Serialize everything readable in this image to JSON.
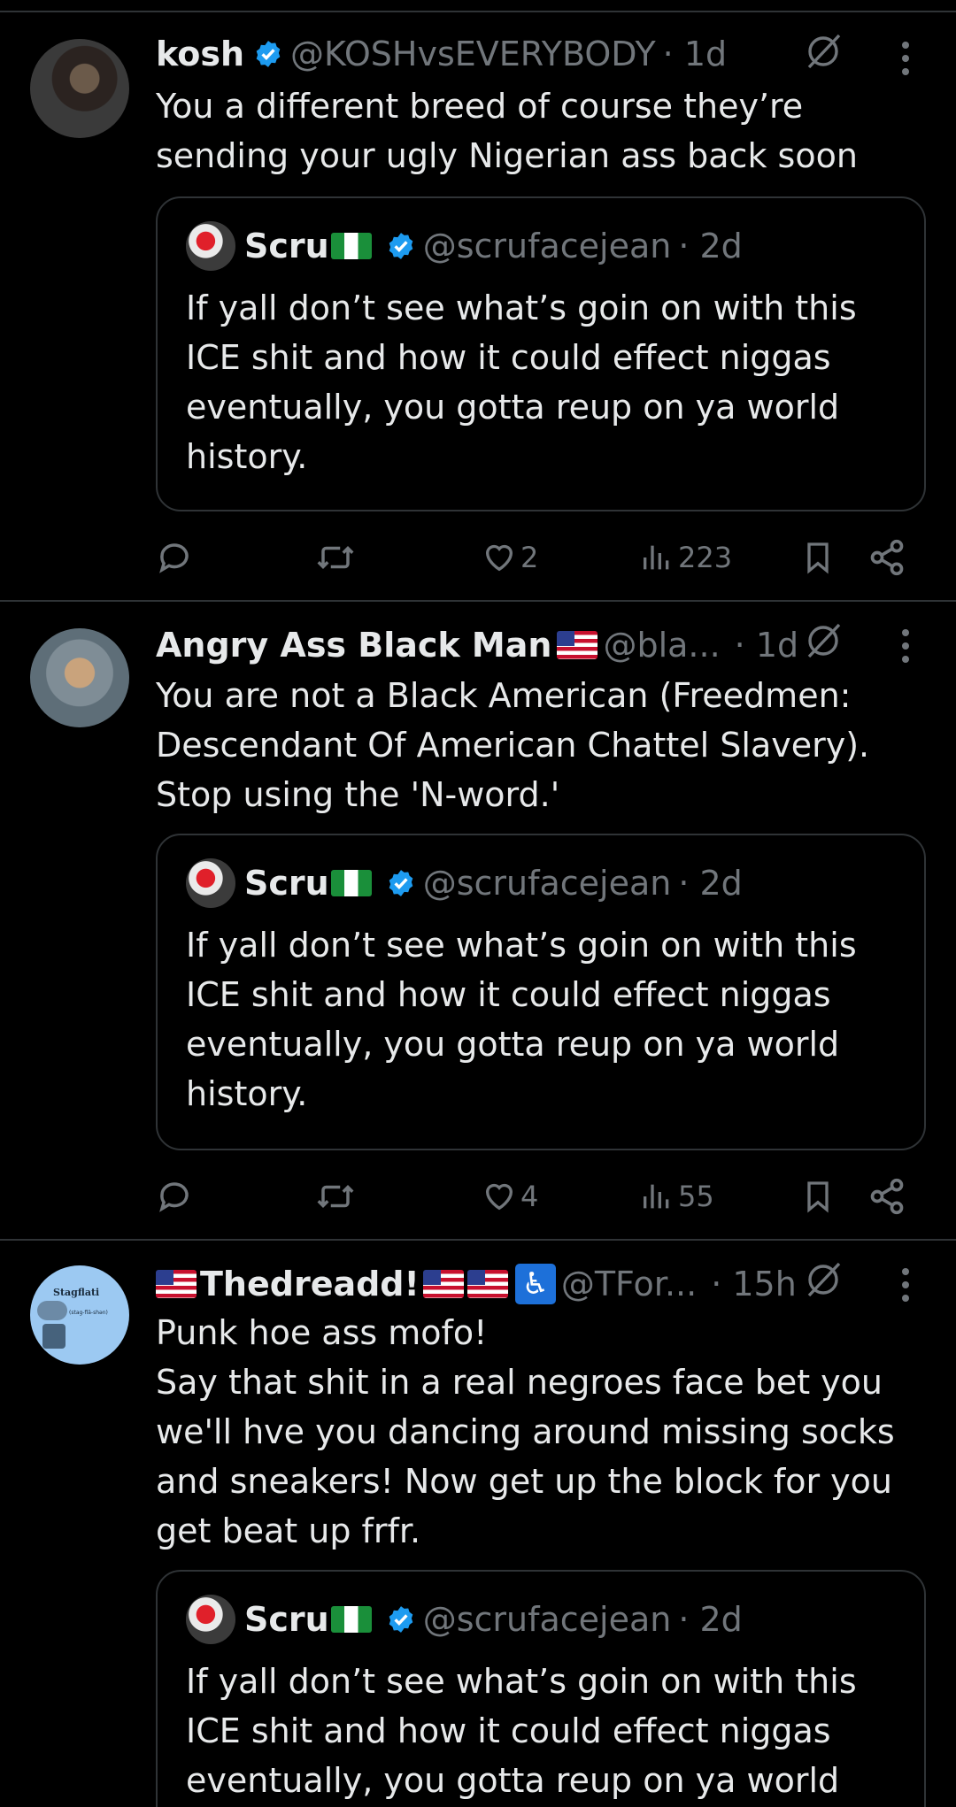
{
  "posts": [
    {
      "name": "kosh",
      "verified": true,
      "handle": "@KOSHvsEVERYBODY",
      "time": "· 1d",
      "text": "You a different breed of course they’re\nsending your ugly Nigerian ass back soon",
      "quote": {
        "name": "Scru",
        "handle": "@scrufacejean",
        "time": "· 2d",
        "text": "If yall don’t see what’s goin on with this\nICE shit and how it could effect niggas\neventually, you gotta reup on ya world\nhistory."
      },
      "likes": "2",
      "views": "223"
    },
    {
      "name": "Angry Ass Black Man",
      "verified": false,
      "handle": "@bla...",
      "time": "· 1d",
      "text": "You are not a Black American (Freedmen:\nDescendant Of American Chattel Slavery).\nStop using the 'N-word.'",
      "quote": {
        "name": "Scru",
        "handle": "@scrufacejean",
        "time": "· 2d",
        "text": "If yall don’t see what’s goin on with this\nICE shit and how it could effect niggas\neventually, you gotta reup on ya world\nhistory."
      },
      "likes": "4",
      "views": "55"
    },
    {
      "name": "Thedreadd!",
      "verified": false,
      "handle": "@TFor...",
      "time": "· 15h",
      "text": "Punk hoe ass mofo!\nSay that shit in a real negroes face bet you\nwe'll hve you dancing around missing socks\nand sneakers! Now get up the block for you\nget beat up frfr.",
      "quote": {
        "name": "Scru",
        "handle": "@scrufacejean",
        "time": "· 2d",
        "text": "If yall don’t see what’s goin on with this\nICE shit and how it could effect niggas\neventually, you gotta reup on ya world"
      },
      "avatar_text": "Stagflati",
      "avatar_subtext": "(stag-flā-shən)"
    }
  ],
  "colors": {
    "background": "#000000",
    "text": "#e7e9ea",
    "muted": "#71767b",
    "border": "#2f3336",
    "verified": "#1d9bf0"
  },
  "icons": [
    "reply-icon",
    "repost-icon",
    "like-icon",
    "views-icon",
    "bookmark-icon",
    "share-icon",
    "grok-icon",
    "more-icon",
    "verified-icon"
  ]
}
